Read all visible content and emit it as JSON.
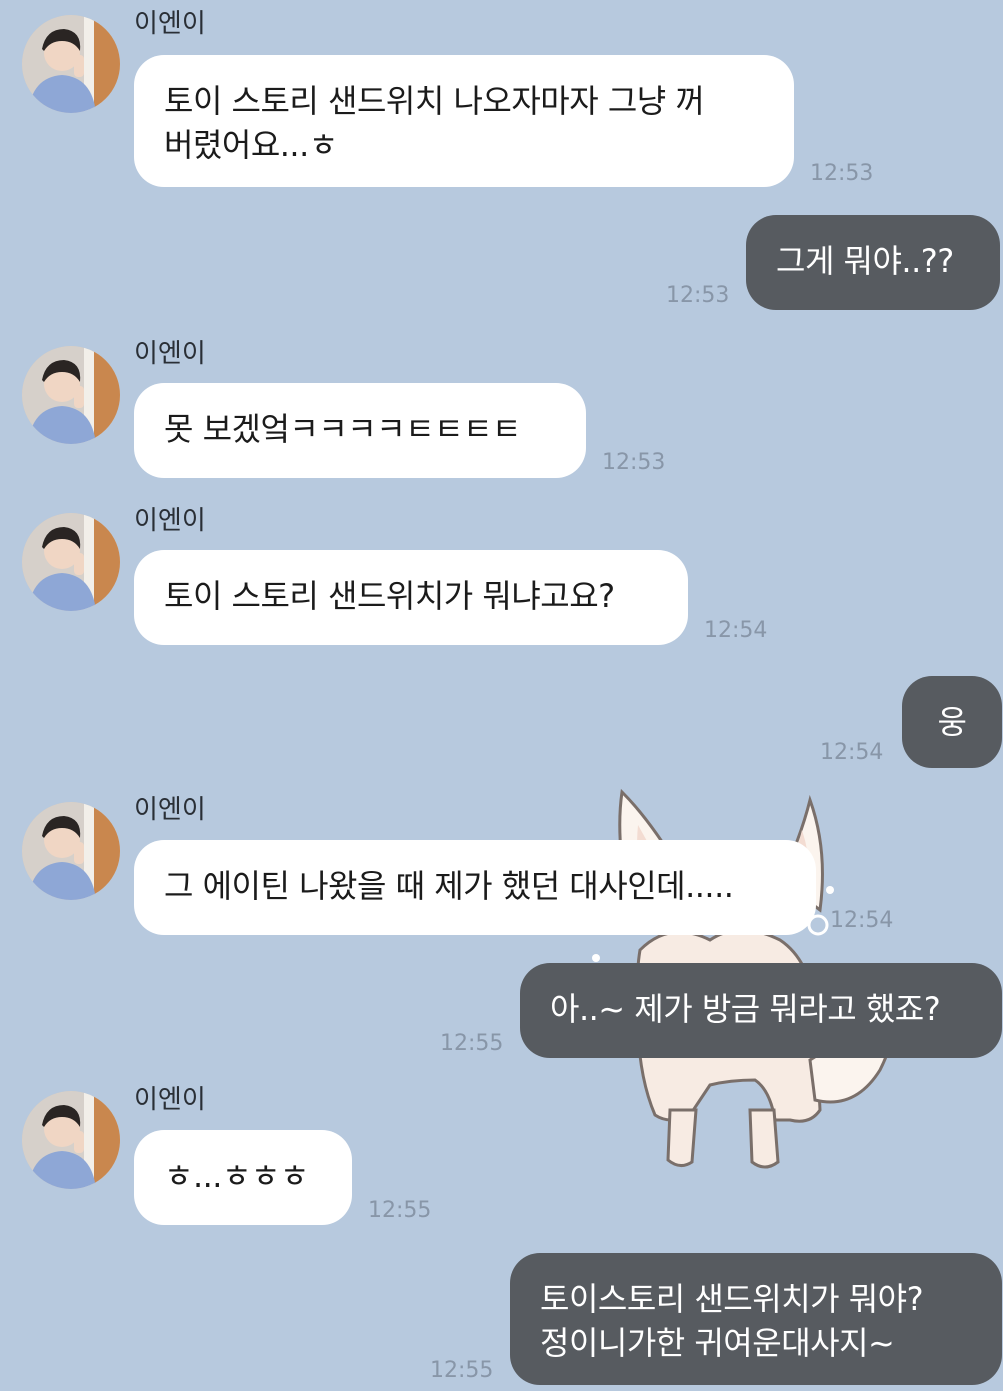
{
  "chat": {
    "contact_name": "이엔이",
    "messages": [
      {
        "dir": "in",
        "lines": [
          "토이 스토리 샌드위치 나오자마자 그냥 꺼",
          "버렸어요...ㅎ"
        ],
        "time": "12:53"
      },
      {
        "dir": "out",
        "lines": [
          "그게 뭐야..??"
        ],
        "time": "12:53"
      },
      {
        "dir": "in",
        "lines": [
          "못 보겠엌ㅋㅋㅋㅋㅌㅌㅌㅌ"
        ],
        "time": "12:53"
      },
      {
        "dir": "in",
        "lines": [
          "토이 스토리 샌드위치가 뭐냐고요?"
        ],
        "time": "12:54"
      },
      {
        "dir": "out",
        "lines": [
          "웅"
        ],
        "time": "12:54"
      },
      {
        "dir": "in",
        "lines": [
          "그 에이틴 나왔을 때 제가 했던 대사인데....."
        ],
        "time": "12:54"
      },
      {
        "dir": "out",
        "lines": [
          "아..~ 제가 방금 뭐라고 했죠?"
        ],
        "time": "12:55"
      },
      {
        "dir": "in",
        "lines": [
          "ㅎ...ㅎㅎㅎ"
        ],
        "time": "12:55"
      },
      {
        "dir": "out",
        "lines": [
          "토이스토리 샌드위치가 뭐야?",
          "정이니가한 귀여운대사지~"
        ],
        "time": "12:55"
      }
    ]
  },
  "colors": {
    "background": "#b7c9de",
    "incoming_bubble": "#ffffff",
    "outgoing_bubble": "#575b60",
    "timestamp": "#8896a8"
  },
  "icons": {
    "avatar": "profile-photo",
    "wallpaper": "fox-illustration"
  }
}
